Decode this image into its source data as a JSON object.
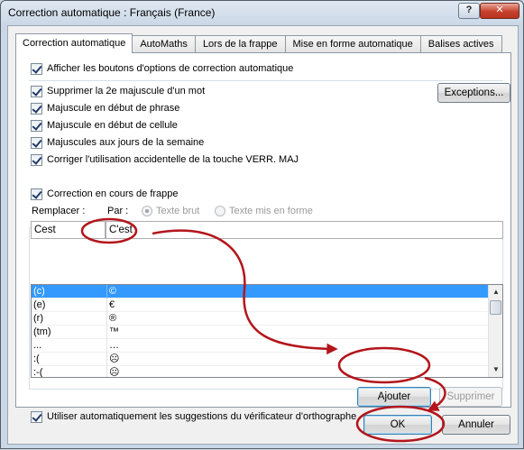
{
  "window": {
    "title": "Correction automatique : Français (France)",
    "help_label": "?",
    "close_label": "✕"
  },
  "tabs": [
    {
      "label": "Correction automatique",
      "active": true
    },
    {
      "label": "AutoMaths"
    },
    {
      "label": "Lors de la frappe"
    },
    {
      "label": "Mise en forme automatique"
    },
    {
      "label": "Balises actives"
    }
  ],
  "options": {
    "show_buttons": "Afficher les boutons d'options de correction automatique",
    "second_capital": "Supprimer la 2e majuscule d'un mot",
    "sentence_capital": "Majuscule en début de phrase",
    "cell_capital": "Majuscule en début de cellule",
    "days_capital": "Majuscules aux jours de la semaine",
    "caps_lock": "Corriger l'utilisation accidentelle de la touche VERR. MAJ",
    "exceptions_label": "Exceptions...",
    "correct_while_typing": "Correction en cours de frappe"
  },
  "replace": {
    "replace_label": "Remplacer :",
    "by_label": "Par :",
    "plain_text": "Texte brut",
    "formatted_text": "Texte mis en forme",
    "replace_value": "Cest",
    "by_value": "C'est"
  },
  "table": {
    "rows": [
      {
        "from": "(c)",
        "to": "©",
        "selected": true
      },
      {
        "from": "(e)",
        "to": "€"
      },
      {
        "from": "(r)",
        "to": "®"
      },
      {
        "from": "(tm)",
        "to": "™"
      },
      {
        "from": "...",
        "to": "…"
      },
      {
        "from": ":(",
        "to": "☹"
      },
      {
        "from": ":-(",
        "to": "☹"
      }
    ]
  },
  "actions": {
    "add_label": "Ajouter",
    "delete_label": "Supprimer",
    "use_suggestions": "Utiliser automatiquement les suggestions du vérificateur d'orthographe",
    "ok_label": "OK",
    "cancel_label": "Annuler"
  },
  "colors": {
    "annotation": "#b3151b",
    "selection": "#3399ff"
  }
}
